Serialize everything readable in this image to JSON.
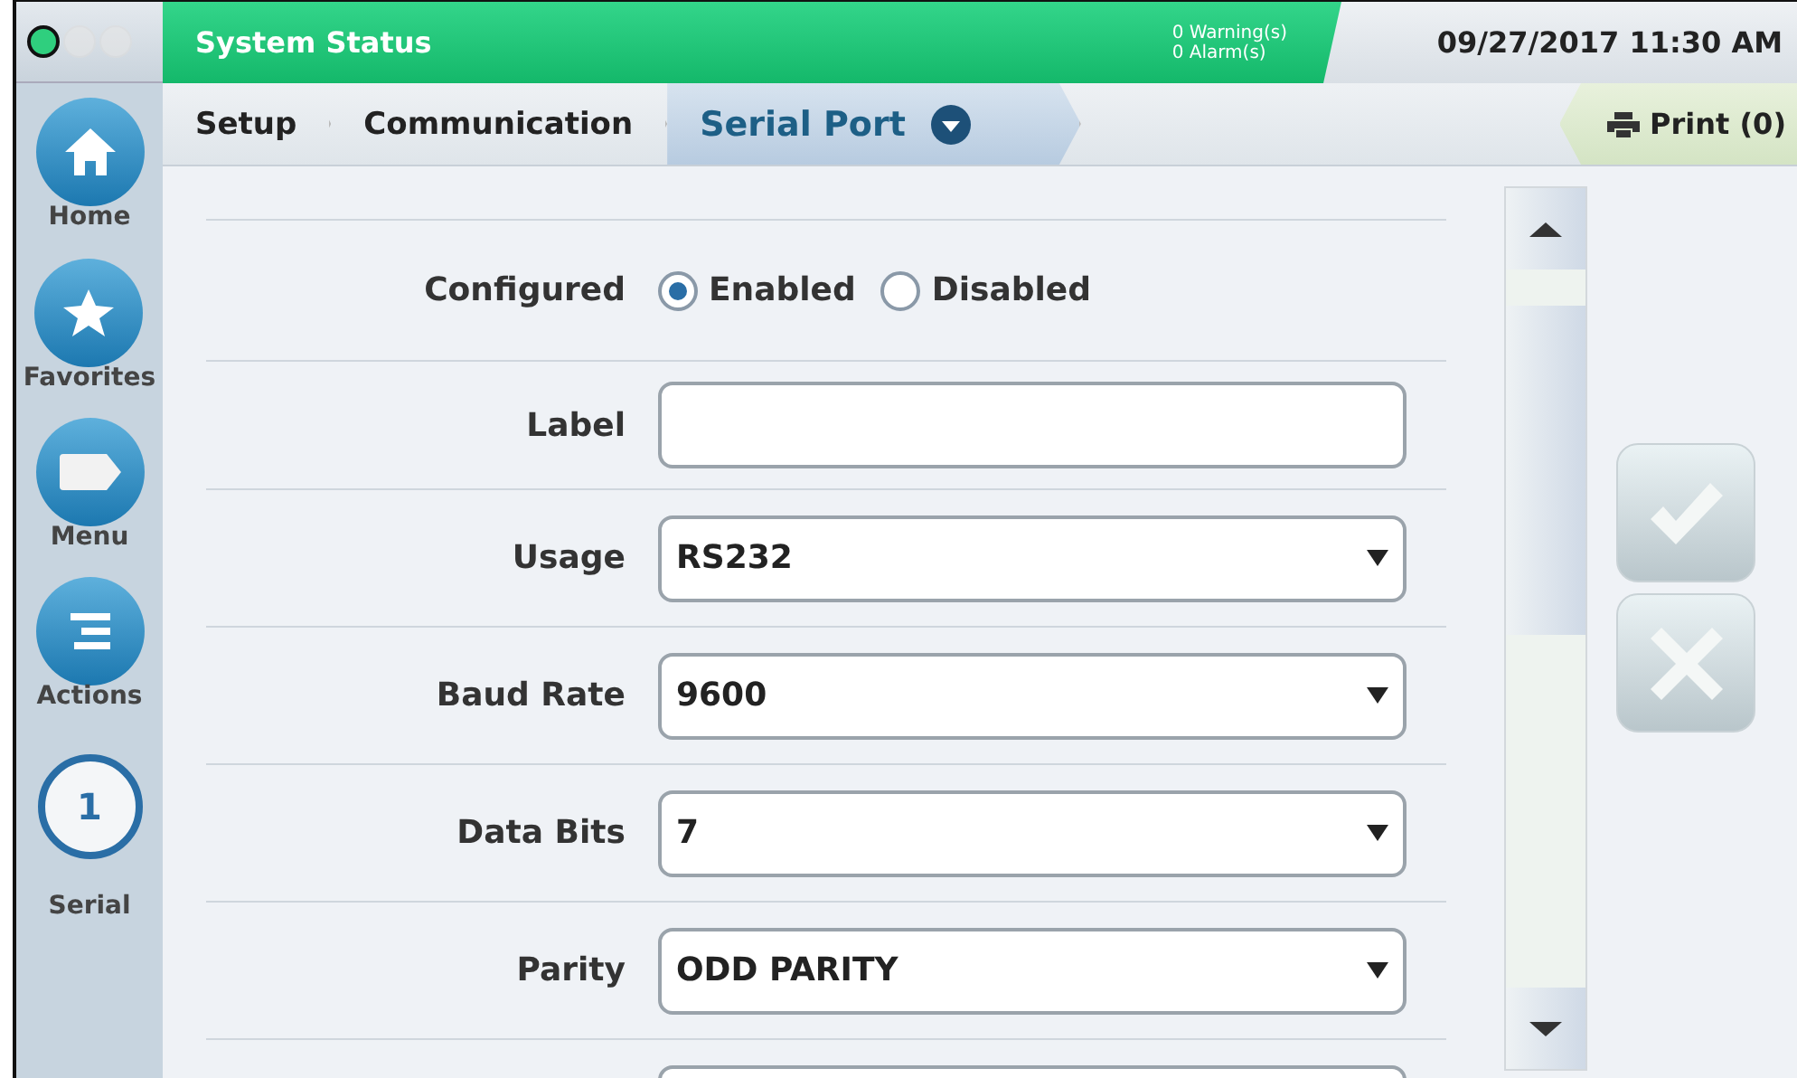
{
  "header": {
    "title": "System Status",
    "warnings": "0 Warning(s)",
    "alarms": "0 Alarm(s)",
    "datetime": "09/27/2017 11:30 AM"
  },
  "breadcrumb": [
    {
      "label": "Setup",
      "selected": false
    },
    {
      "label": "Communication",
      "selected": false
    },
    {
      "label": "Serial Port",
      "selected": true
    }
  ],
  "print": "Print (0)",
  "sidebar": [
    {
      "kind": "home",
      "label": "Home"
    },
    {
      "kind": "favorites",
      "label": "Favorites"
    },
    {
      "kind": "menu",
      "label": "Menu"
    },
    {
      "kind": "actions",
      "label": "Actions"
    },
    {
      "kind": "badge",
      "label": "Serial",
      "badge": "1"
    }
  ],
  "form": [
    {
      "kind": "radio",
      "label": "Configured",
      "options": [
        {
          "label": "Enabled",
          "selected": true
        },
        {
          "label": "Disabled",
          "selected": false
        }
      ]
    },
    {
      "kind": "text",
      "label": "Label"
    },
    {
      "kind": "select",
      "label": "Usage",
      "value": "RS232"
    },
    {
      "kind": "select",
      "label": "Baud Rate",
      "value": "9600"
    },
    {
      "kind": "select",
      "label": "Data Bits",
      "value": "7"
    },
    {
      "kind": "select",
      "label": "Parity",
      "value": "ODD PARITY"
    }
  ]
}
